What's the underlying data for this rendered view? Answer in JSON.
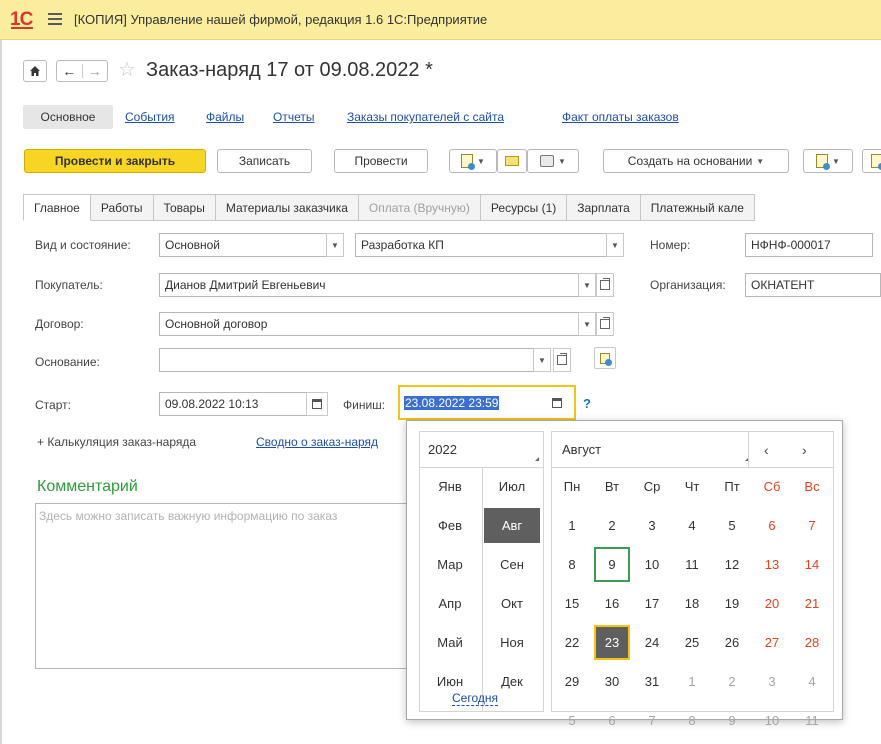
{
  "app": {
    "title": "[КОПИЯ] Управление нашей фирмой, редакция 1.6 1С:Предприятие",
    "logo": "1С"
  },
  "document": {
    "title": "Заказ-наряд 17 от 09.08.2022 *"
  },
  "sections": [
    "Основное",
    "События",
    "Файлы",
    "Отчеты",
    "Заказы покупателей с сайта",
    "Факт оплаты заказов"
  ],
  "toolbar": {
    "post_close": "Провести и закрыть",
    "save": "Записать",
    "post": "Провести",
    "create_based": "Создать на основании"
  },
  "tabs": [
    "Главное",
    "Работы",
    "Товары",
    "Материалы заказчика",
    "Оплата (Вручную)",
    "Ресурсы (1)",
    "Зарплата",
    "Платежный кале"
  ],
  "form": {
    "kind_label": "Вид и состояние:",
    "kind_value": "Основной",
    "state_value": "Разработка КП",
    "number_label": "Номер:",
    "number_value": "НФНФ-000017",
    "customer_label": "Покупатель:",
    "customer_value": "Дианов Дмитрий Евгеньевич",
    "org_label": "Организация:",
    "org_value": "ОКНАТЕНТ",
    "contract_label": "Договор:",
    "contract_value": "Основной договор",
    "basis_label": "Основание:",
    "basis_value": "",
    "start_label": "Старт:",
    "start_value": "09.08.2022 10:13",
    "finish_label": "Финиш:",
    "finish_value": "23.08.2022 23:59",
    "help": "?",
    "calc_label": "+ Калькуляция заказ-наряда",
    "summary_link": "Сводно о заказ-наряд",
    "comment_title": "Комментарий",
    "comment_placeholder": "Здесь можно записать важную информацию по заказ"
  },
  "calendar": {
    "year": "2022",
    "month": "Август",
    "prev": "‹",
    "next": "›",
    "months_left": [
      "Янв",
      "Фев",
      "Мар",
      "Апр",
      "Май",
      "Июн"
    ],
    "months_right": [
      "Июл",
      "Авг",
      "Сен",
      "Окт",
      "Ноя",
      "Дек"
    ],
    "selected_month": "Авг",
    "weekdays": [
      "Пн",
      "Вт",
      "Ср",
      "Чт",
      "Пт",
      "Сб",
      "Вс"
    ],
    "weeks": [
      [
        "1",
        "2",
        "3",
        "4",
        "5",
        "6",
        "7"
      ],
      [
        "8",
        "9",
        "10",
        "11",
        "12",
        "13",
        "14"
      ],
      [
        "15",
        "16",
        "17",
        "18",
        "19",
        "20",
        "21"
      ],
      [
        "22",
        "23",
        "24",
        "25",
        "26",
        "27",
        "28"
      ],
      [
        "29",
        "30",
        "31",
        "1",
        "2",
        "3",
        "4"
      ],
      [
        "5",
        "6",
        "7",
        "8",
        "9",
        "10",
        "11"
      ]
    ],
    "today": "9",
    "selected_day": "23",
    "today_link": "Сегодня"
  }
}
